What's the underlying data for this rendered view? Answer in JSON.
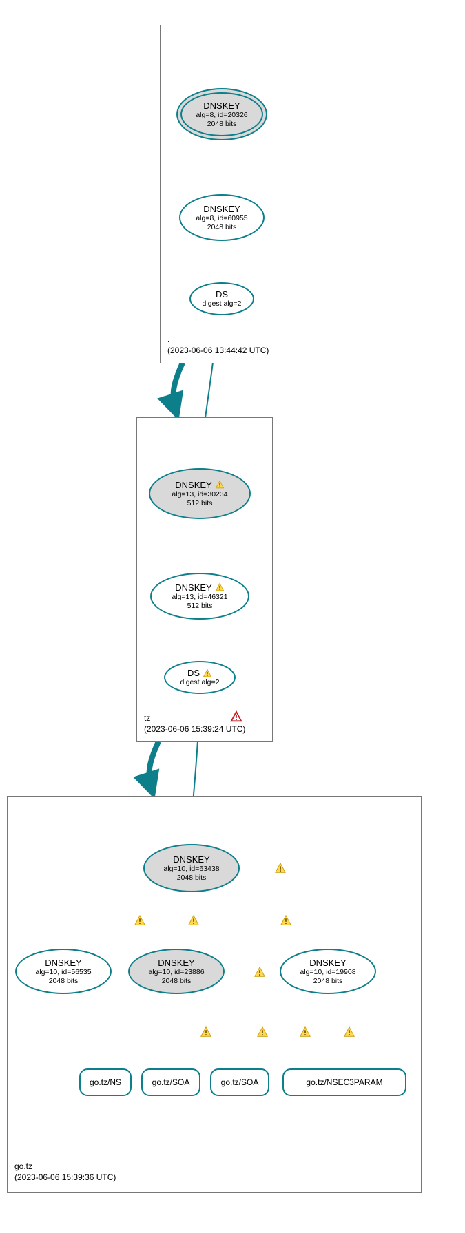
{
  "zones": {
    "root": {
      "name": ".",
      "timestamp": "(2023-06-06 13:44:42 UTC)"
    },
    "tz": {
      "name": "tz",
      "timestamp": "(2023-06-06 15:39:24 UTC)"
    },
    "gotz": {
      "name": "go.tz",
      "timestamp": "(2023-06-06 15:39:36 UTC)"
    }
  },
  "nodes": {
    "root_ksk": {
      "title": "DNSKEY",
      "l1": "alg=8, id=20326",
      "l2": "2048 bits"
    },
    "root_zsk": {
      "title": "DNSKEY",
      "l1": "alg=8, id=60955",
      "l2": "2048 bits"
    },
    "root_ds": {
      "title": "DS",
      "l1": "digest alg=2",
      "l2": ""
    },
    "tz_ksk": {
      "title": "DNSKEY",
      "l1": "alg=13, id=30234",
      "l2": "512 bits"
    },
    "tz_zsk": {
      "title": "DNSKEY",
      "l1": "alg=13, id=46321",
      "l2": "512 bits"
    },
    "tz_ds": {
      "title": "DS",
      "l1": "digest alg=2",
      "l2": ""
    },
    "gotz_ksk": {
      "title": "DNSKEY",
      "l1": "alg=10, id=63438",
      "l2": "2048 bits"
    },
    "gotz_k2": {
      "title": "DNSKEY",
      "l1": "alg=10, id=56535",
      "l2": "2048 bits"
    },
    "gotz_k3": {
      "title": "DNSKEY",
      "l1": "alg=10, id=23886",
      "l2": "2048 bits"
    },
    "gotz_k4": {
      "title": "DNSKEY",
      "l1": "alg=10, id=19908",
      "l2": "2048 bits"
    },
    "rr_ns": {
      "label": "go.tz/NS"
    },
    "rr_soa1": {
      "label": "go.tz/SOA"
    },
    "rr_soa2": {
      "label": "go.tz/SOA"
    },
    "rr_nsec3": {
      "label": "go.tz/NSEC3PARAM"
    }
  },
  "chart_data": {
    "type": "graph",
    "description": "DNSSEC authentication/delegation chain for go.tz",
    "zones": [
      {
        "id": "root",
        "name": ".",
        "timestamp": "2023-06-06 13:44:42 UTC",
        "status": "secure"
      },
      {
        "id": "tz",
        "name": "tz",
        "timestamp": "2023-06-06 15:39:24 UTC",
        "status": "error"
      },
      {
        "id": "gotz",
        "name": "go.tz",
        "timestamp": "2023-06-06 15:39:36 UTC",
        "status": "secure"
      }
    ],
    "nodes": [
      {
        "id": "root_ksk",
        "zone": "root",
        "type": "DNSKEY",
        "role": "KSK",
        "alg": 8,
        "key_id": 20326,
        "bits": 2048,
        "trust_anchor": true,
        "warn": false
      },
      {
        "id": "root_zsk",
        "zone": "root",
        "type": "DNSKEY",
        "role": "ZSK",
        "alg": 8,
        "key_id": 60955,
        "bits": 2048,
        "warn": false
      },
      {
        "id": "root_ds",
        "zone": "root",
        "type": "DS",
        "digest_alg": 2,
        "warn": false
      },
      {
        "id": "tz_ksk",
        "zone": "tz",
        "type": "DNSKEY",
        "role": "KSK",
        "alg": 13,
        "key_id": 30234,
        "bits": 512,
        "warn": true
      },
      {
        "id": "tz_zsk",
        "zone": "tz",
        "type": "DNSKEY",
        "role": "ZSK",
        "alg": 13,
        "key_id": 46321,
        "bits": 512,
        "warn": true
      },
      {
        "id": "tz_ds",
        "zone": "tz",
        "type": "DS",
        "digest_alg": 2,
        "warn": true
      },
      {
        "id": "gotz_ksk",
        "zone": "gotz",
        "type": "DNSKEY",
        "role": "KSK",
        "alg": 10,
        "key_id": 63438,
        "bits": 2048,
        "warn": false
      },
      {
        "id": "gotz_k2",
        "zone": "gotz",
        "type": "DNSKEY",
        "alg": 10,
        "key_id": 56535,
        "bits": 2048,
        "warn": false
      },
      {
        "id": "gotz_k3",
        "zone": "gotz",
        "type": "DNSKEY",
        "role": "KSK",
        "alg": 10,
        "key_id": 23886,
        "bits": 2048,
        "warn": false
      },
      {
        "id": "gotz_k4",
        "zone": "gotz",
        "type": "DNSKEY",
        "alg": 10,
        "key_id": 19908,
        "bits": 2048,
        "warn": false
      },
      {
        "id": "rr_ns",
        "zone": "gotz",
        "type": "RRset",
        "name": "go.tz/NS"
      },
      {
        "id": "rr_soa1",
        "zone": "gotz",
        "type": "RRset",
        "name": "go.tz/SOA"
      },
      {
        "id": "rr_soa2",
        "zone": "gotz",
        "type": "RRset",
        "name": "go.tz/SOA"
      },
      {
        "id": "rr_nsec3",
        "zone": "gotz",
        "type": "RRset",
        "name": "go.tz/NSEC3PARAM"
      }
    ],
    "edges": [
      {
        "from": "root_ksk",
        "to": "root_ksk",
        "kind": "self-sign",
        "warn": false
      },
      {
        "from": "root_ksk",
        "to": "root_zsk",
        "kind": "signs",
        "warn": false
      },
      {
        "from": "root_zsk",
        "to": "root_ds",
        "kind": "signs",
        "warn": false
      },
      {
        "from": "root_ds",
        "to": "tz_ksk",
        "kind": "delegation",
        "warn": false
      },
      {
        "from": "root",
        "to": "tz",
        "kind": "zone-delegation",
        "warn": false,
        "thick": true
      },
      {
        "from": "tz_ksk",
        "to": "tz_ksk",
        "kind": "self-sign",
        "warn": false
      },
      {
        "from": "tz_ksk",
        "to": "tz_zsk",
        "kind": "signs",
        "warn": false
      },
      {
        "from": "tz_zsk",
        "to": "tz_ds",
        "kind": "signs",
        "warn": false
      },
      {
        "from": "tz_ds",
        "to": "gotz_ksk",
        "kind": "delegation",
        "warn": false
      },
      {
        "from": "tz",
        "to": "gotz",
        "kind": "zone-delegation",
        "warn": false,
        "thick": true
      },
      {
        "from": "gotz_ksk",
        "to": "gotz_ksk",
        "kind": "self-sign",
        "warn": true
      },
      {
        "from": "gotz_ksk",
        "to": "gotz_k2",
        "kind": "signs",
        "warn": true
      },
      {
        "from": "gotz_ksk",
        "to": "gotz_k3",
        "kind": "signs",
        "warn": true
      },
      {
        "from": "gotz_ksk",
        "to": "gotz_k4",
        "kind": "signs",
        "warn": true
      },
      {
        "from": "gotz_k3",
        "to": "gotz_k3",
        "kind": "self-sign",
        "warn": true
      },
      {
        "from": "gotz_k4",
        "to": "rr_ns",
        "kind": "signs",
        "warn": false
      },
      {
        "from": "gotz_k4",
        "to": "rr_soa1",
        "kind": "signs",
        "warn": true
      },
      {
        "from": "gotz_k4",
        "to": "rr_soa2",
        "kind": "signs",
        "warn": true
      },
      {
        "from": "gotz_k4",
        "to": "rr_nsec3",
        "kind": "signs",
        "warn": true
      },
      {
        "from": "gotz_k3",
        "to": "rr_ns",
        "kind": "signs",
        "warn": false
      },
      {
        "from": "gotz_k3",
        "to": "rr_soa1",
        "kind": "signs",
        "warn": true
      }
    ]
  }
}
